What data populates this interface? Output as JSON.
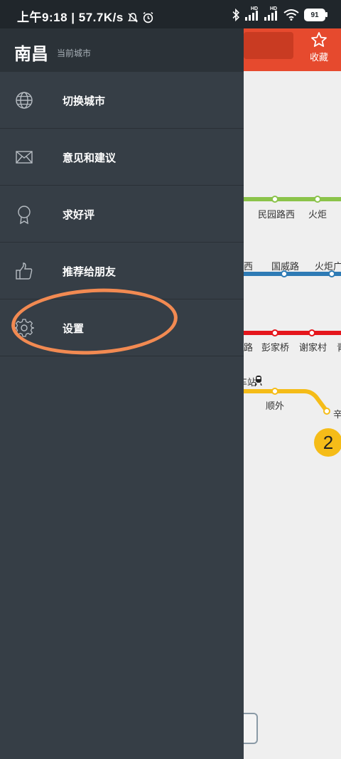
{
  "status_bar": {
    "time": "上午9:18",
    "network_speed": "57.7K/s",
    "signal_1_label": "HD",
    "signal_2_label": "HD",
    "battery": "91"
  },
  "drawer": {
    "city": "南昌",
    "city_subtitle": "当前城市",
    "items": [
      {
        "label": "切换城市",
        "icon": "globe-icon"
      },
      {
        "label": "意见和建议",
        "icon": "envelope-icon"
      },
      {
        "label": "求好评",
        "icon": "award-icon"
      },
      {
        "label": "推荐给朋友",
        "icon": "thumbs-up-icon"
      },
      {
        "label": "设置",
        "icon": "gear-icon"
      }
    ]
  },
  "map": {
    "favorite_label": "收藏",
    "stations": [
      "民园路西",
      "火炬",
      "西",
      "国威路",
      "火炬广",
      "路",
      "彭家桥",
      "谢家村",
      "青",
      "车站",
      "顺外",
      "辛"
    ],
    "line_badge": "2",
    "colors": {
      "green_line": "#8bc34a",
      "blue_line": "#2e7bb5",
      "red_line": "#e5161c",
      "yellow_line": "#f5bc18",
      "header": "#e64a2e"
    }
  },
  "annotation": {
    "highlight_color": "#f28a52"
  }
}
